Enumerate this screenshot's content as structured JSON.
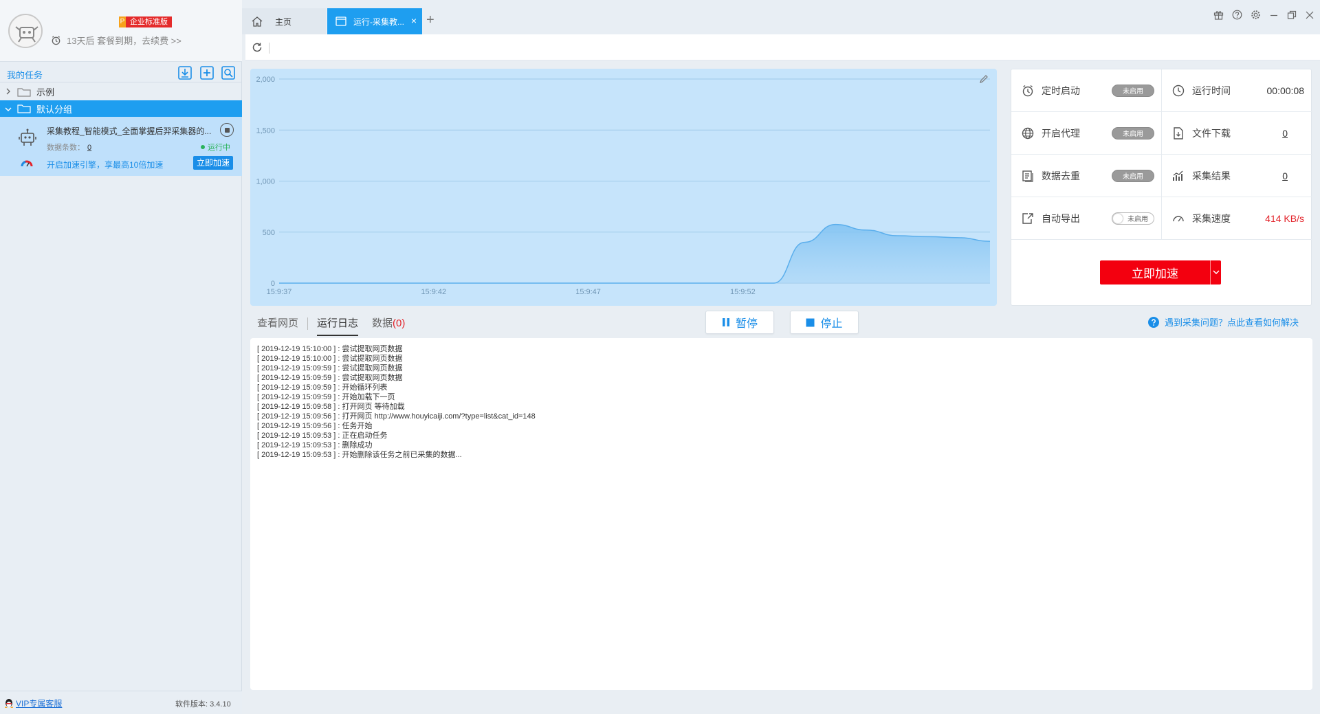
{
  "profile": {
    "edition_letter": "P",
    "edition": "企业标准版",
    "expire_text": "13天后 套餐到期，去续费 >>"
  },
  "sidebar": {
    "title": "我的任务",
    "groups": [
      {
        "label": "示例",
        "expanded": false
      },
      {
        "label": "默认分组",
        "expanded": true
      }
    ],
    "task": {
      "title": "采集教程_智能模式_全面掌握后羿采集器的...",
      "count_label": "数据条数：",
      "count_value": "0",
      "status": "运行中",
      "boost_text": "开启加速引擎，享最高10倍加速",
      "boost_button": "立即加速"
    },
    "footer": {
      "vip_link": "VIP专属客服",
      "version": "软件版本: 3.4.10"
    }
  },
  "tabs": {
    "home": "主页",
    "run": "运行-采集教...",
    "add": "+"
  },
  "colors": {
    "accent": "#1e9ef0",
    "chart_fill": "#c6e4fb",
    "danger": "#f3000f",
    "running": "#2ab25a"
  },
  "chart_data": {
    "type": "area",
    "x": [
      "15:9:37",
      "15:9:38",
      "15:9:39",
      "15:9:40",
      "15:9:41",
      "15:9:42",
      "15:9:43",
      "15:9:44",
      "15:9:45",
      "15:9:46",
      "15:9:47",
      "15:9:48",
      "15:9:49",
      "15:9:50",
      "15:9:51",
      "15:9:52",
      "15:9:53",
      "15:9:54",
      "15:9:55",
      "15:9:56",
      "15:9:57",
      "15:9:58",
      "15:9:59",
      "15:10:00"
    ],
    "values": [
      0,
      0,
      0,
      0,
      0,
      0,
      0,
      0,
      0,
      0,
      0,
      0,
      0,
      0,
      0,
      0,
      0,
      400,
      575,
      520,
      465,
      455,
      445,
      410
    ],
    "x_ticks": [
      "15:9:37",
      "15:9:42",
      "15:9:47",
      "15:9:52"
    ],
    "y_ticks": [
      "2,000",
      "1,500",
      "1,000",
      "500",
      "0"
    ],
    "ylim": [
      0,
      2000
    ],
    "grid": true,
    "legend": "none"
  },
  "stats": {
    "scheduled_start": {
      "label": "定时启动",
      "state": "未启用"
    },
    "run_time": {
      "label": "运行时间",
      "value": "00:00:08"
    },
    "proxy": {
      "label": "开启代理",
      "state": "未启用"
    },
    "file_download": {
      "label": "文件下载",
      "value": "0"
    },
    "dedupe": {
      "label": "数据去重",
      "state": "未启用"
    },
    "results": {
      "label": "采集结果",
      "value": "0"
    },
    "auto_export": {
      "label": "自动导出",
      "state": "未启用"
    },
    "speed": {
      "label": "采集速度",
      "value": "414 KB/s"
    },
    "accelerate_button": "立即加速"
  },
  "log": {
    "tabs": [
      "查看网页",
      "运行日志",
      "数据"
    ],
    "data_count": "(0)",
    "pause_label": "暂停",
    "stop_label": "停止",
    "help_text": "遇到采集问题？点此查看如何解决",
    "lines": [
      "[ 2019-12-19 15:10:00 ] : 尝试提取网页数据",
      "[ 2019-12-19 15:10:00 ] : 尝试提取网页数据",
      "[ 2019-12-19 15:09:59 ] : 尝试提取网页数据",
      "[ 2019-12-19 15:09:59 ] : 尝试提取网页数据",
      "[ 2019-12-19 15:09:59 ] : 开始循环列表",
      "[ 2019-12-19 15:09:59 ] : 开始加载下一页",
      "[ 2019-12-19 15:09:58 ] : 打开网页 等待加载",
      "[ 2019-12-19 15:09:56 ] : 打开网页 http://www.houyicaiji.com/?type=list&cat_id=148",
      "[ 2019-12-19 15:09:56 ] : 任务开始",
      "[ 2019-12-19 15:09:53 ] : 正在启动任务",
      "[ 2019-12-19 15:09:53 ] : 删除成功",
      "[ 2019-12-19 15:09:53 ] : 开始删除该任务之前已采集的数据..."
    ]
  }
}
